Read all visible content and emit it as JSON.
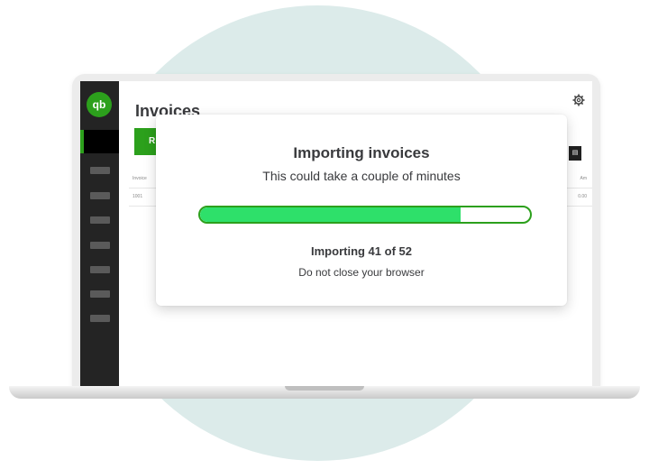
{
  "app": {
    "logo_text": "qb",
    "page_title": "Invoices",
    "new_button_label": "R",
    "table": {
      "header_left": "Invoice",
      "header_right": "Am",
      "row_left": "1001",
      "row_right": "0.00"
    }
  },
  "modal": {
    "title": "Importing invoices",
    "subtitle": "This could take a couple of minutes",
    "status": "Importing 41 of 52",
    "warning": "Do not close your browser",
    "progress": {
      "current": 41,
      "total": 52
    }
  },
  "colors": {
    "brand_green": "#2ca01c",
    "progress_fill": "#2ee06a",
    "sidebar": "#242424",
    "background_circle": "#dcebea"
  },
  "icons": [
    "qb-logo-icon",
    "gear-icon"
  ]
}
